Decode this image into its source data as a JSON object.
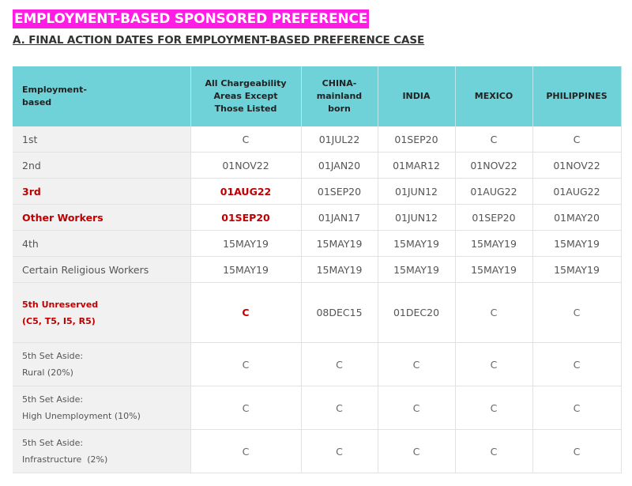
{
  "heading": "EMPLOYMENT-BASED SPONSORED PREFERENCE",
  "subheading": "A. FINAL ACTION DATES FOR EMPLOYMENT-BASED PREFERENCE CASE",
  "columns": [
    {
      "line1": "Employment-",
      "line2": "based",
      "line3": ""
    },
    {
      "line1": "All Chargeability",
      "line2": "Areas Except",
      "line3": "Those Listed"
    },
    {
      "line1": "CHINA-",
      "line2": "mainland",
      "line3": "born"
    },
    {
      "line1": "INDIA",
      "line2": "",
      "line3": ""
    },
    {
      "line1": "MEXICO",
      "line2": "",
      "line3": ""
    },
    {
      "line1": "PHILIPPINES",
      "line2": "",
      "line3": ""
    }
  ],
  "rows": [
    {
      "label1": "1st",
      "label2": "",
      "cells": [
        "C",
        "01JUL22",
        "01SEP20",
        "C",
        "C"
      ]
    },
    {
      "label1": "2nd",
      "label2": "",
      "cells": [
        "01NOV22",
        "01JAN20",
        "01MAR12",
        "01NOV22",
        "01NOV22"
      ]
    },
    {
      "label1": "3rd",
      "label2": "",
      "cells": [
        "01AUG22",
        "01SEP20",
        "01JUN12",
        "01AUG22",
        "01AUG22"
      ]
    },
    {
      "label1": "Other Workers",
      "label2": "",
      "cells": [
        "01SEP20",
        "01JAN17",
        "01JUN12",
        "01SEP20",
        "01MAY20"
      ]
    },
    {
      "label1": "4th",
      "label2": "",
      "cells": [
        "15MAY19",
        "15MAY19",
        "15MAY19",
        "15MAY19",
        "15MAY19"
      ]
    },
    {
      "label1": "Certain Religious Workers",
      "label2": "",
      "cells": [
        "15MAY19",
        "15MAY19",
        "15MAY19",
        "15MAY19",
        "15MAY19"
      ]
    },
    {
      "label1": "5th Unreserved",
      "label2": "(C5, T5, I5, R5)",
      "cells": [
        "C",
        "08DEC15",
        "01DEC20",
        "C",
        "C"
      ]
    },
    {
      "label1": "5th Set Aside:",
      "label2": "Rural (20%)",
      "cells": [
        "C",
        "C",
        "C",
        "C",
        "C"
      ]
    },
    {
      "label1": "5th Set Aside:",
      "label2": "High Unemployment (10%)",
      "cells": [
        "C",
        "C",
        "C",
        "C",
        "C"
      ]
    },
    {
      "label1": "5th Set Aside:",
      "label2": "Infrastructure  (2%)",
      "cells": [
        "C",
        "C",
        "C",
        "C",
        "C"
      ]
    }
  ]
}
